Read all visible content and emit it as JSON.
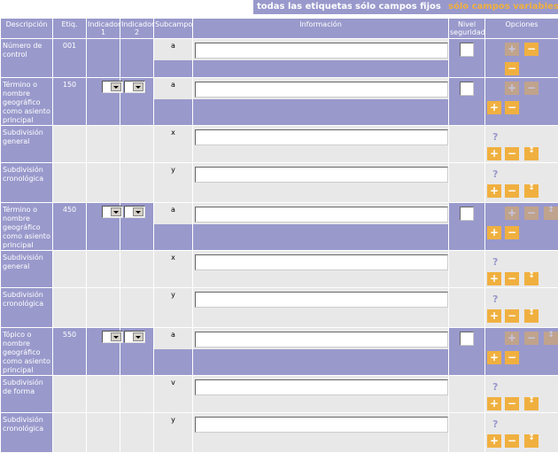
{
  "tabs": [
    {
      "label": "todas las etiquetas",
      "active": false
    },
    {
      "label": "sólo campos fijos",
      "active": false
    },
    {
      "label": "sólo campos variables",
      "active": true
    }
  ],
  "headers": {
    "descripcion": "Descripción",
    "etiq": "Etiq.",
    "ind1": "Indicador 1",
    "ind2": "Indicador 2",
    "subcampo": "Subcampo",
    "informacion": "Información",
    "nivel": "Nivel seguridad",
    "opciones": "Opciones"
  },
  "icons": {
    "help": "?",
    "plus": "+",
    "minus": "−",
    "updown": "↕"
  },
  "colors": {
    "header": "#9999cc",
    "accent": "#f0b040",
    "light": "#e8e8e8"
  },
  "rows": [
    {
      "desc": "Número de control",
      "tag": "001",
      "subfield": "a"
    },
    {
      "desc": "Término o nombre geográfico como asiento principal",
      "tag": "150",
      "subfield": "a"
    },
    {
      "desc": "Subdivisión general",
      "tag": "",
      "subfield": "x"
    },
    {
      "desc": "Subdivisión cronológica",
      "tag": "",
      "subfield": "y"
    },
    {
      "desc": "Término o nombre geográfico como asiento principal",
      "tag": "450",
      "subfield": "a"
    },
    {
      "desc": "Subdivisión general",
      "tag": "",
      "subfield": "x"
    },
    {
      "desc": "Subdivisión cronológica",
      "tag": "",
      "subfield": "y"
    },
    {
      "desc": "Tópico o nombre geográfico como asiento principal",
      "tag": "550",
      "subfield": "a"
    },
    {
      "desc": "Subdivisión de forma",
      "tag": "",
      "subfield": "v"
    },
    {
      "desc": "Subdivisión cronológica",
      "tag": "",
      "subfield": "y"
    }
  ]
}
